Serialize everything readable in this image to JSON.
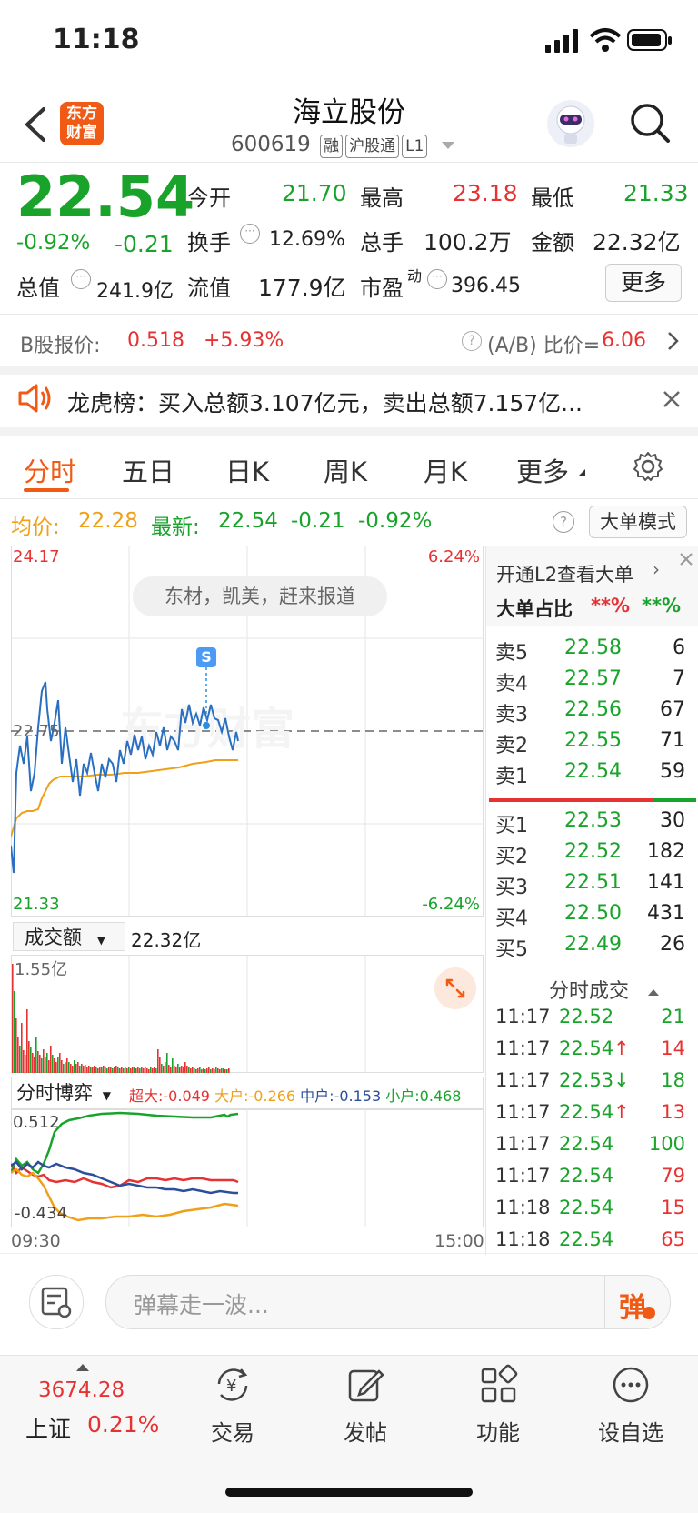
{
  "status_bar": {
    "time": "11:18"
  },
  "header": {
    "app_logo": "东方\n财富",
    "logo_line1": "东方",
    "logo_line2": "财富",
    "title": "海立股份",
    "code": "600619",
    "tags": [
      "融",
      "沪股通",
      "L1"
    ]
  },
  "quote": {
    "price": "22.54",
    "change_pct": "-0.92%",
    "change": "-0.21",
    "fields": {
      "open_label": "今开",
      "open": "21.70",
      "high_label": "最高",
      "high": "23.18",
      "low_label": "最低",
      "low": "21.33",
      "turnover_label": "换手",
      "turnover": "12.69%",
      "volume_label": "总手",
      "volume": "100.2万",
      "amount_label": "金额",
      "amount": "22.32亿",
      "mktcap_label": "总值",
      "mktcap": "241.9亿",
      "float_label": "流值",
      "float": "177.9亿",
      "pe_label": "市盈",
      "pe_sup": "动",
      "pe": "396.45"
    },
    "more_button": "更多"
  },
  "b_share": {
    "label": "B股报价:",
    "price": "0.518",
    "change": "+5.93%",
    "ratio_label": "(A/B) 比价=",
    "ratio": "6.06"
  },
  "notice": {
    "text": "龙虎榜：买入总额3.107亿元，卖出总额7.157亿..."
  },
  "tabs": [
    "分时",
    "五日",
    "日K",
    "周K",
    "月K",
    "更多"
  ],
  "active_tab": "分时",
  "info_line": {
    "avg_label": "均价:",
    "avg": "22.28",
    "latest_label": "最新:",
    "latest": "22.54",
    "chg": "-0.21",
    "chg_pct": "-0.92%",
    "mode_button": "大单模式"
  },
  "chart_labels": {
    "y_top": "24.17",
    "y_top_pct": "6.24%",
    "y_mid": "22.75",
    "y_bottom": "21.33",
    "y_bottom_pct": "-6.24%",
    "bubble": "东材，凯美，赶来报道",
    "marker": "S",
    "watermark": "东方财富"
  },
  "volume_panel": {
    "selector": "成交额",
    "value": "22.32亿",
    "max_label": "1.55亿"
  },
  "flow_panel": {
    "selector": "分时博弈",
    "super_label": "超大:",
    "super": "-0.049",
    "large_label": "大户:",
    "large": "-0.266",
    "mid_label": "中户:",
    "mid": "-0.153",
    "small_label": "小户:",
    "small": "0.468",
    "y_top": "0.512",
    "y_bottom": "-0.434",
    "time_start": "09:30",
    "time_end": "15:00"
  },
  "side_panel": {
    "l2_link": "开通L2查看大单",
    "ratio_label": "大单占比",
    "ratio_red": "**%",
    "ratio_green": "**%",
    "asks": [
      {
        "label": "卖5",
        "price": "22.58",
        "vol": "6"
      },
      {
        "label": "卖4",
        "price": "22.57",
        "vol": "7"
      },
      {
        "label": "卖3",
        "price": "22.56",
        "vol": "67"
      },
      {
        "label": "卖2",
        "price": "22.55",
        "vol": "71"
      },
      {
        "label": "卖1",
        "price": "22.54",
        "vol": "59"
      }
    ],
    "bids": [
      {
        "label": "买1",
        "price": "22.53",
        "vol": "30"
      },
      {
        "label": "买2",
        "price": "22.52",
        "vol": "182"
      },
      {
        "label": "买3",
        "price": "22.51",
        "vol": "141"
      },
      {
        "label": "买4",
        "price": "22.50",
        "vol": "431"
      },
      {
        "label": "买5",
        "price": "22.49",
        "vol": "26"
      }
    ],
    "ticks_title": "分时成交",
    "ticks": [
      {
        "time": "11:17",
        "price": "22.52",
        "arrow": "",
        "vol": "21",
        "vol_color": "green"
      },
      {
        "time": "11:17",
        "price": "22.54",
        "arrow": "↑",
        "vol": "14",
        "vol_color": "red"
      },
      {
        "time": "11:17",
        "price": "22.53",
        "arrow": "↓",
        "vol": "18",
        "vol_color": "green"
      },
      {
        "time": "11:17",
        "price": "22.54",
        "arrow": "↑",
        "vol": "13",
        "vol_color": "red"
      },
      {
        "time": "11:17",
        "price": "22.54",
        "arrow": "",
        "vol": "100",
        "vol_color": "green"
      },
      {
        "time": "11:17",
        "price": "22.54",
        "arrow": "",
        "vol": "79",
        "vol_color": "red"
      },
      {
        "time": "11:18",
        "price": "22.54",
        "arrow": "",
        "vol": "15",
        "vol_color": "red"
      },
      {
        "time": "11:18",
        "price": "22.54",
        "arrow": "",
        "vol": "65",
        "vol_color": "red"
      }
    ]
  },
  "comment_bar": {
    "placeholder": "弹幕走一波...",
    "danmu_button": "弹"
  },
  "bottom_nav": {
    "index_value": "3674.28",
    "index_name": "上证",
    "index_change": "0.21%",
    "items": [
      {
        "label": "交易",
        "icon": "trade-icon"
      },
      {
        "label": "发帖",
        "icon": "post-icon"
      },
      {
        "label": "功能",
        "icon": "apps-icon"
      },
      {
        "label": "设自选",
        "icon": "add-watchlist-icon"
      }
    ]
  },
  "colors": {
    "up": "#e63232",
    "down": "#1aa32b",
    "avg": "#f0a018",
    "price_line": "#2a6fc0",
    "accent": "#f05a14"
  }
}
